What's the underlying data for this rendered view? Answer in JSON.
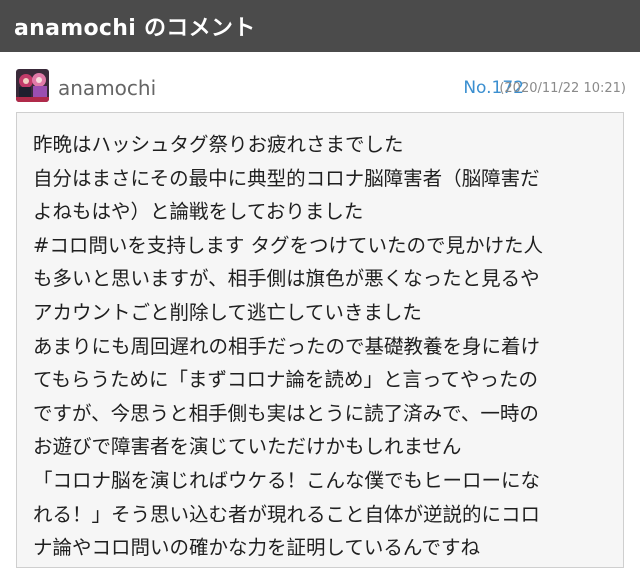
{
  "header": {
    "title": "anamochi のコメント"
  },
  "comment": {
    "author": "anamochi",
    "avatar_icon": "avatar-icon",
    "number": "No.172",
    "timestamp": "(2020/11/22 10:21)",
    "lines": [
      "昨晩はハッシュタグ祭りお疲れさまでした",
      "自分はまさにその最中に典型的コロナ脳障害者（脳障害だ",
      "よねもはや）と論戦をしておりました",
      "#コロ問いを支持します タグをつけていたので見かけた人",
      "も多いと思いますが、相手側は旗色が悪くなったと見るや",
      "アカウントごと削除して逃亡していきました",
      "あまりにも周回遅れの相手だったので基礎教養を身に着け",
      "てもらうために「まずコロナ論を読め」と言ってやったの",
      "ですが、今思うと相手側も実はとうに読了済みで、一時の",
      "お遊びで障害者を演じていただけかもしれません",
      "「コロナ脳を演じればウケる！こんな僕でもヒーローにな",
      "れる！」そう思い込む者が現れること自体が逆説的にコロ",
      "ナ論やコロ問いの確かな力を証明しているんですね"
    ]
  },
  "colors": {
    "header_bg": "#4b4b4b",
    "number_blue": "#3b8fd0",
    "box_bg": "#f6f6f6"
  }
}
